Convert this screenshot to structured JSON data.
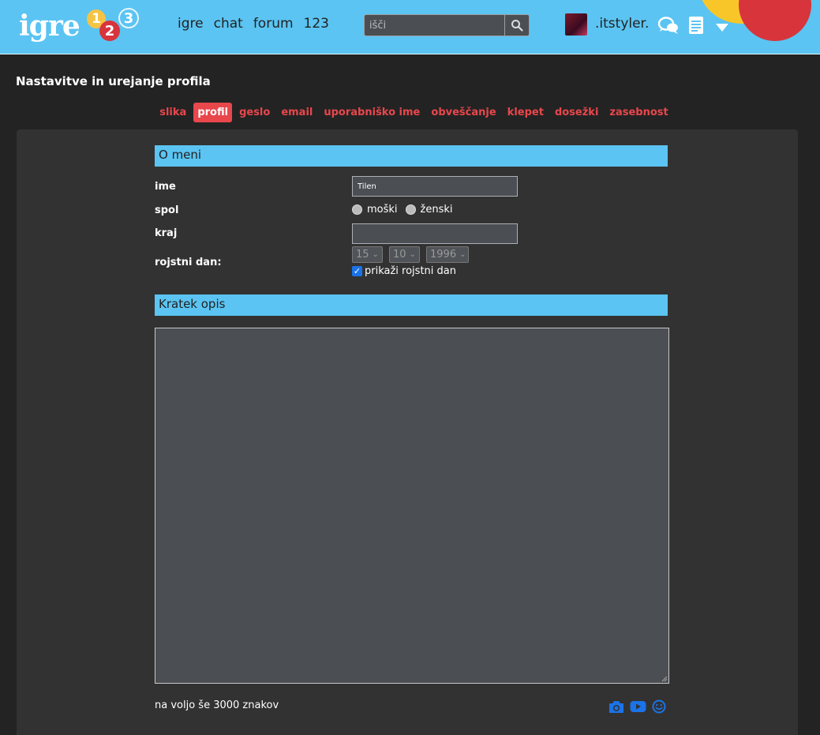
{
  "header": {
    "logo_text": "igre",
    "logo_digits": [
      "1",
      "2",
      "3"
    ],
    "nav": [
      "igre",
      "chat",
      "forum",
      "123"
    ],
    "search_placeholder": "išči",
    "username": ".itstyler."
  },
  "page": {
    "title": "Nastavitve in urejanje profila",
    "tabs": [
      "slika",
      "profil",
      "geslo",
      "email",
      "uporabniško ime",
      "obveščanje",
      "klepet",
      "dosežki",
      "zasebnost"
    ],
    "active_tab": "profil"
  },
  "about": {
    "heading": "O meni",
    "name_label": "ime",
    "name_value": "Tilen",
    "gender_label": "spol",
    "gender_options": [
      "moški",
      "ženski"
    ],
    "city_label": "kraj",
    "city_value": "",
    "birthday_label": "rojstni dan:",
    "birthday_day": "15",
    "birthday_month": "10",
    "birthday_year": "1996",
    "show_birthday_label": "prikaži rojstni dan",
    "show_birthday_checked": true
  },
  "description": {
    "heading": "Kratek opis",
    "value": "",
    "remaining_text": "na voljo še 3000 znakov"
  },
  "colors": {
    "header_bg": "#5bc4f2",
    "accent_red": "#e8474c",
    "panel_bg": "#323232",
    "icon_blue": "#1a73e8"
  },
  "icons": [
    "search-icon",
    "chat-bubbles-icon",
    "document-icon",
    "caret-down-icon",
    "camera-icon",
    "youtube-icon",
    "smiley-icon"
  ]
}
